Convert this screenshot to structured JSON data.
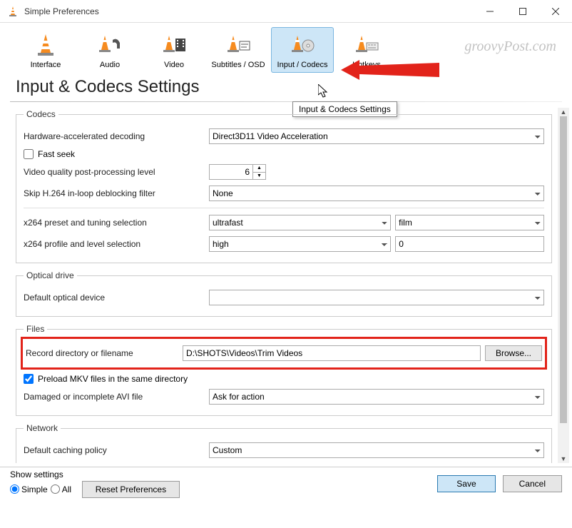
{
  "window": {
    "title": "Simple Preferences"
  },
  "tabs": [
    {
      "label": "Interface"
    },
    {
      "label": "Audio"
    },
    {
      "label": "Video"
    },
    {
      "label": "Subtitles / OSD"
    },
    {
      "label": "Input / Codecs"
    },
    {
      "label": "Hotkeys"
    }
  ],
  "heading": "Input & Codecs Settings",
  "tooltip": "Input & Codecs Settings",
  "codecs": {
    "legend": "Codecs",
    "hw_label": "Hardware-accelerated decoding",
    "hw_value": "Direct3D11 Video Acceleration",
    "fastseek_label": "Fast seek",
    "vq_label": "Video quality post-processing level",
    "vq_value": "6",
    "skip_label": "Skip H.264 in-loop deblocking filter",
    "skip_value": "None",
    "x264preset_label": "x264 preset and tuning selection",
    "x264preset_value": "ultrafast",
    "x264tune_value": "film",
    "x264profile_label": "x264 profile and level selection",
    "x264profile_value": "high",
    "x264level_value": "0"
  },
  "optical": {
    "legend": "Optical drive",
    "label": "Default optical device",
    "value": ""
  },
  "files": {
    "legend": "Files",
    "record_label": "Record directory or filename",
    "record_value": "D:\\SHOTS\\Videos\\Trim Videos",
    "browse": "Browse...",
    "preload_label": "Preload MKV files in the same directory",
    "avi_label": "Damaged or incomplete AVI file",
    "avi_value": "Ask for action"
  },
  "network": {
    "legend": "Network",
    "cache_label": "Default caching policy",
    "cache_value": "Custom"
  },
  "footer": {
    "show_label": "Show settings",
    "simple": "Simple",
    "all": "All",
    "reset": "Reset Preferences",
    "save": "Save",
    "cancel": "Cancel"
  },
  "watermark": "groovyPost.com"
}
